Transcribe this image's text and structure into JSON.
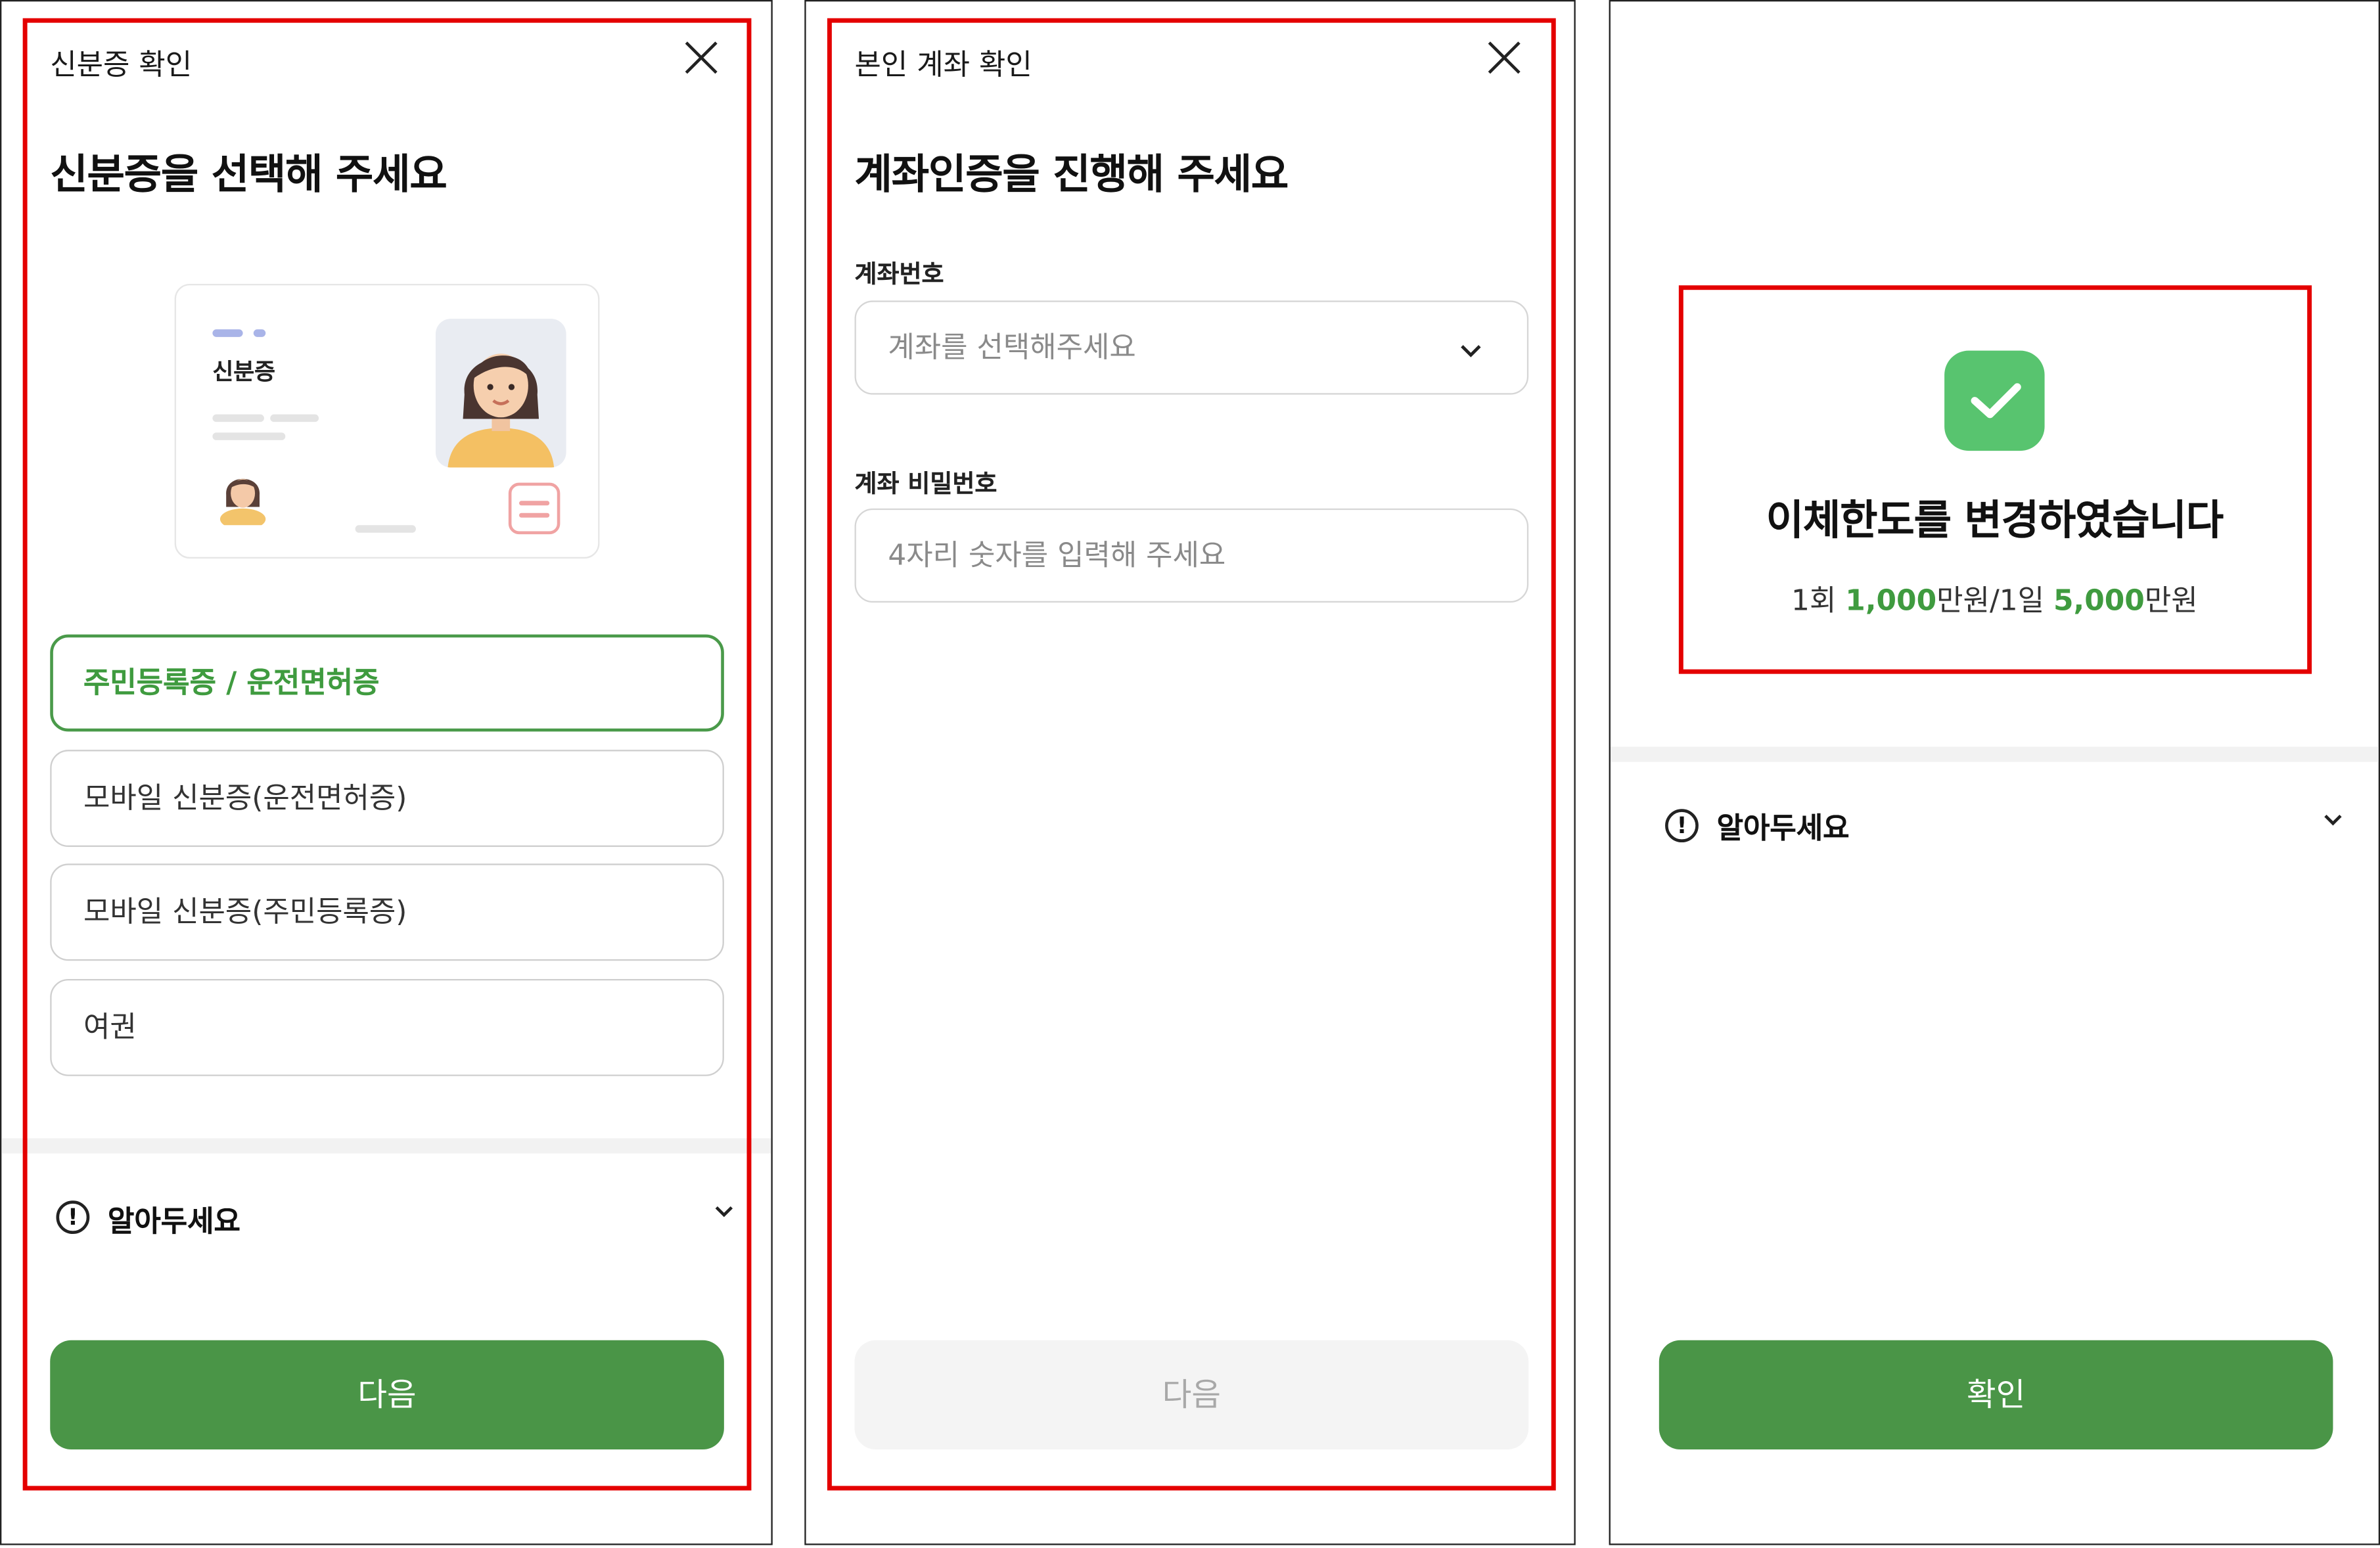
{
  "panel1": {
    "header_title": "신분증 확인",
    "heading": "신분증을 선택해 주세요",
    "card_label": "신분증",
    "options": [
      {
        "label": "주민등록증 / 운전면허증",
        "selected": true
      },
      {
        "label": "모바일 신분증(운전면허증)",
        "selected": false
      },
      {
        "label": "모바일 신분증(주민등록증)",
        "selected": false
      },
      {
        "label": "여권",
        "selected": false
      }
    ],
    "notice_label": "알아두세요",
    "next_button": "다음"
  },
  "panel2": {
    "header_title": "본인 계좌 확인",
    "heading": "계좌인증을 진행해 주세요",
    "account_label": "계좌번호",
    "account_placeholder": "계좌를 선택해주세요",
    "password_label": "계좌 비밀번호",
    "password_placeholder": "4자리 숫자를 입력해 주세요",
    "next_button": "다음"
  },
  "panel3": {
    "success_title": "이체한도를 변경하였습니다",
    "limit": {
      "once_prefix": "1회 ",
      "once_value": "1,000",
      "once_unit": "만원",
      "separator": "/",
      "day_prefix": "1일 ",
      "day_value": "5,000",
      "day_unit": "만원"
    },
    "notice_label": "알아두세요",
    "confirm_button": "확인"
  },
  "colors": {
    "accent_green": "#4a9547",
    "highlight_red": "#e40000",
    "success_icon": "#58c46f"
  },
  "icons": [
    "close-icon",
    "exclamation-circle-icon",
    "chevron-down-icon",
    "check-icon",
    "avatar-illustration"
  ]
}
